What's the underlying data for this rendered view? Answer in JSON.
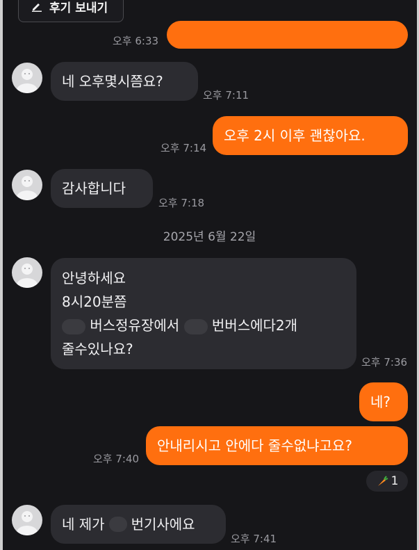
{
  "header": {
    "review_button_label": "후기 보내기"
  },
  "messages": {
    "t0": "오후 6:33",
    "m1": {
      "text": "네 오후몇시쯤요?",
      "time": "오후 7:11"
    },
    "m2": {
      "text": "오후 2시 이후 괜찮아요.",
      "time": "오후 7:14"
    },
    "m3": {
      "text": "감사합니다",
      "time": "오후 7:18"
    },
    "date": "2025년 6월 22일",
    "m4": {
      "line1": "안녕하세요",
      "line2": "8시20분쯤",
      "line3a": "버스정유장에서",
      "line3b": "번버스에다2개",
      "line4": "줄수있나요?",
      "time": "오후 7:36"
    },
    "m5": {
      "text": "네?"
    },
    "m6": {
      "text": "안내리시고 안에다 줄수없냐고요?",
      "time": "오후 7:40"
    },
    "reaction": {
      "icon": "carrot-icon",
      "count": "1"
    },
    "m7": {
      "text_a": "네 제가",
      "text_b": "번기사에요",
      "time": "오후 7:41"
    }
  },
  "colors": {
    "background": "#161619",
    "incoming_bubble": "#2c2c31",
    "outgoing_bubble": "#ff6f0f"
  }
}
